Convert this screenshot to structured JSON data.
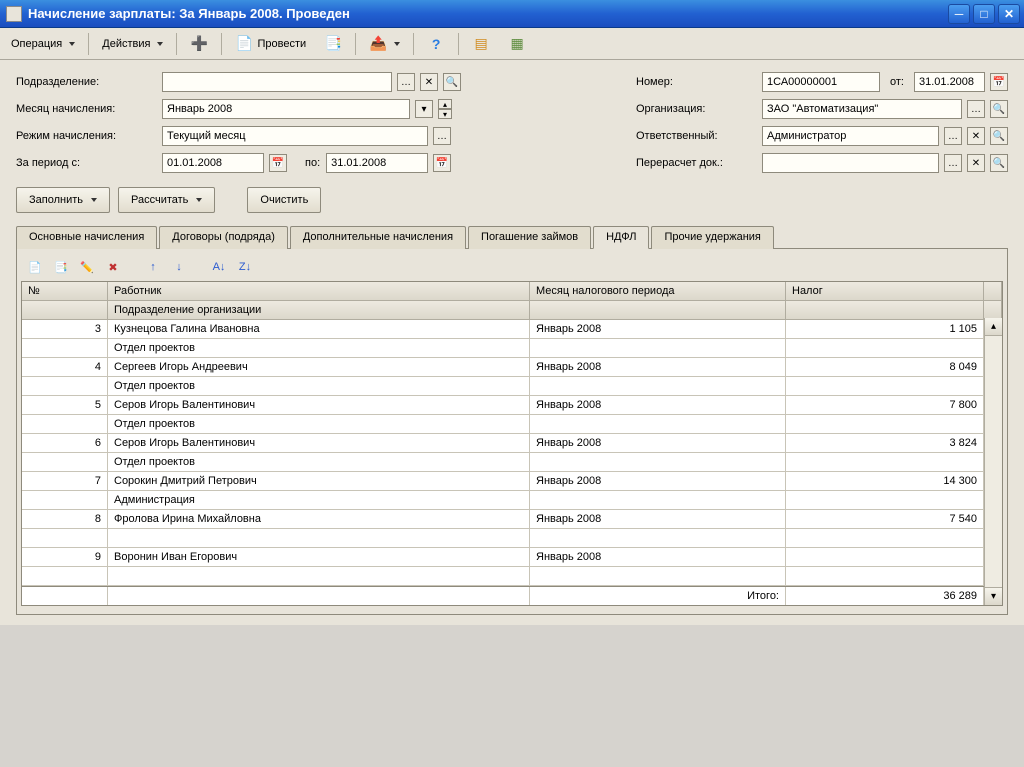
{
  "window": {
    "title": "Начисление зарплаты: За Январь 2008. Проведен"
  },
  "toolbar": {
    "operation": "Операция",
    "actions": "Действия",
    "post": "Провести"
  },
  "form": {
    "labels": {
      "department": "Подразделение:",
      "month": "Месяц начисления:",
      "mode": "Режим начисления:",
      "period_from": "За период с:",
      "period_to": "по:",
      "number": "Номер:",
      "date": "от:",
      "org": "Организация:",
      "responsible": "Ответственный:",
      "recalc": "Перерасчет док.:"
    },
    "values": {
      "department": "",
      "month": "Январь 2008",
      "mode": "Текущий месяц",
      "period_from": "01.01.2008",
      "period_to": "31.01.2008",
      "number": "1СА00000001",
      "date": "31.01.2008",
      "org": "ЗАО \"Автоматизация\"",
      "responsible": "Администратор",
      "recalc": ""
    }
  },
  "buttons": {
    "fill": "Заполнить",
    "calc": "Рассчитать",
    "clear": "Очистить"
  },
  "tabs": {
    "main": "Основные начисления",
    "contracts": "Договоры (подряда)",
    "additional": "Дополнительные начисления",
    "loans": "Погашение займов",
    "ndfl": "НДФЛ",
    "other": "Прочие удержания"
  },
  "grid": {
    "headers": {
      "num": "№",
      "employee": "Работник",
      "subunit": "Подразделение организации",
      "month": "Месяц налогового периода",
      "tax": "Налог"
    },
    "rows": [
      {
        "num": "3",
        "employee": "Кузнецова Галина Ивановна",
        "subunit": "Отдел проектов",
        "month": "Январь 2008",
        "tax": "1 105"
      },
      {
        "num": "4",
        "employee": "Сергеев Игорь Андреевич",
        "subunit": "Отдел проектов",
        "month": "Январь 2008",
        "tax": "8 049"
      },
      {
        "num": "5",
        "employee": "Серов Игорь Валентинович",
        "subunit": "Отдел проектов",
        "month": "Январь 2008",
        "tax": "7 800"
      },
      {
        "num": "6",
        "employee": "Серов Игорь Валентинович",
        "subunit": "Отдел проектов",
        "month": "Январь 2008",
        "tax": "3 824"
      },
      {
        "num": "7",
        "employee": "Сорокин Дмитрий Петрович",
        "subunit": "Администрация",
        "month": "Январь 2008",
        "tax": "14 300"
      },
      {
        "num": "8",
        "employee": "Фролова Ирина Михайловна",
        "subunit": "",
        "month": "Январь 2008",
        "tax": "7 540"
      },
      {
        "num": "9",
        "employee": "Воронин Иван Егорович",
        "subunit": "",
        "month": "Январь 2008",
        "tax": ""
      }
    ],
    "footer": {
      "total_label": "Итого:",
      "total_value": "36 289"
    }
  }
}
